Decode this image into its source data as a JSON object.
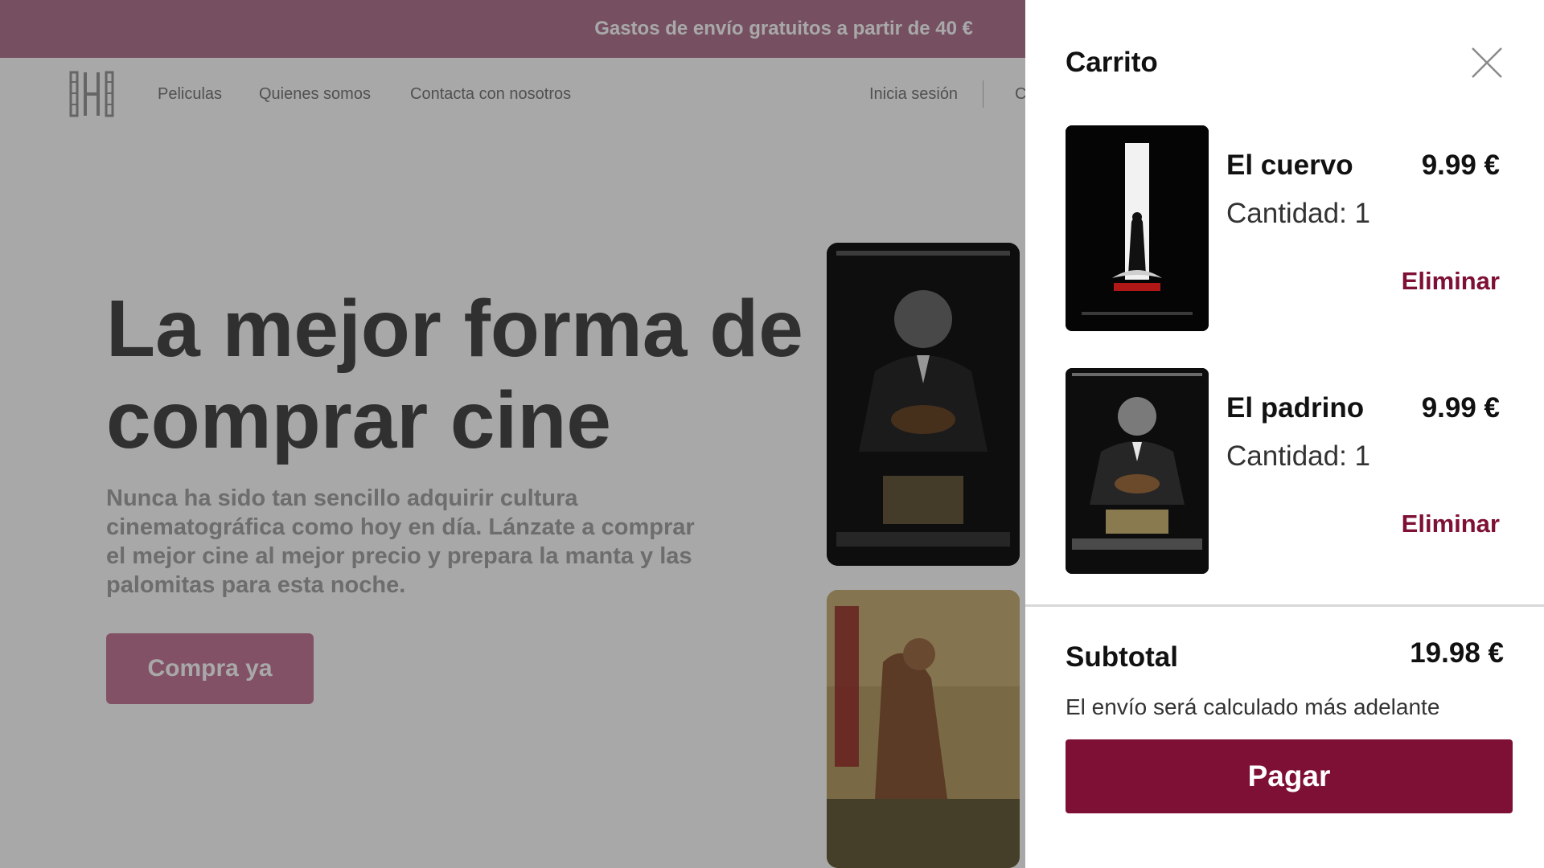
{
  "announcement": "Gastos de envío gratuitos a partir de 40 €",
  "nav": {
    "links": [
      "Peliculas",
      "Quienes somos",
      "Contacta con nosotros"
    ],
    "login": "Inicia sesión",
    "cart_partial": "C"
  },
  "hero": {
    "title_line1": "La mejor forma de",
    "title_line2": "comprar cine",
    "text": "Nunca ha sido tan sencillo adquirir cultura cinematográfica como hoy en día. Lánzate a comprar el mejor cine al mejor precio y prepara la manta y las palomitas para esta noche.",
    "cta": "Compra ya"
  },
  "cart": {
    "title": "Carrito",
    "items": [
      {
        "title": "El cuervo",
        "price": "9.99 €",
        "quantity": "Cantidad: 1",
        "remove": "Eliminar"
      },
      {
        "title": "El padrino",
        "price": "9.99 €",
        "quantity": "Cantidad: 1",
        "remove": "Eliminar"
      }
    ],
    "subtotal_label": "Subtotal",
    "subtotal_value": "19.98 €",
    "shipping_note": "El envío será calculado más adelante",
    "pay": "Pagar"
  },
  "colors": {
    "brand": "#7e1036",
    "announcement_bg": "#b47a93",
    "cta_bg": "#c77c9a"
  },
  "icons": {
    "logo": "film-strip-logo-icon",
    "close": "close-icon"
  }
}
